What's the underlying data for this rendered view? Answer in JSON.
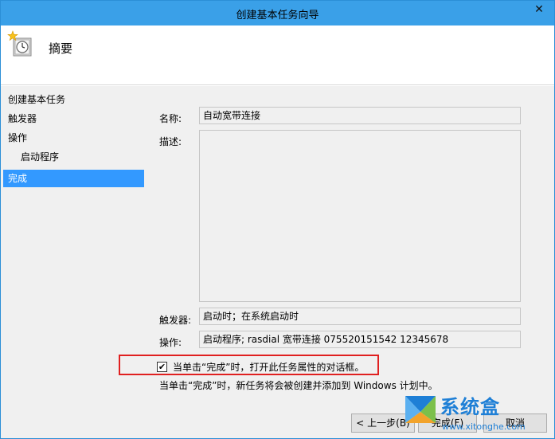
{
  "window": {
    "title": "创建基本任务向导",
    "close_glyph": "✕"
  },
  "header": {
    "title": "摘要",
    "icon": "task-clock-icon"
  },
  "sidebar": {
    "items": [
      {
        "label": "创建基本任务",
        "active": false,
        "sub": false
      },
      {
        "label": "触发器",
        "active": false,
        "sub": false
      },
      {
        "label": "操作",
        "active": false,
        "sub": false
      },
      {
        "label": "启动程序",
        "active": false,
        "sub": true
      },
      {
        "label": "完成",
        "active": true,
        "sub": false
      }
    ]
  },
  "summary": {
    "name_label": "名称:",
    "name_value": "自动宽带连接",
    "description_label": "描述:",
    "description_value": "",
    "trigger_label": "触发器:",
    "trigger_value": "启动时；在系统启动时",
    "action_label": "操作:",
    "action_value": "启动程序; rasdial 宽带连接 075520151542 12345678"
  },
  "option": {
    "checkbox_label": "当单击“完成”时，打开此任务属性的对话框。",
    "checked": true,
    "check_glyph": "✔"
  },
  "note": "当单击“完成”时，新任务将会被创建并添加到 Windows 计划中。",
  "buttons": {
    "back": "< 上一步(B)",
    "finish": "完成(F)",
    "cancel": "取消"
  },
  "watermark": {
    "text": "系统盒",
    "url": "www.xitonghe.com",
    "color": "#1e7fd6"
  },
  "colors": {
    "titlebar": "#3aa0e8",
    "selected": "#3399ff",
    "highlight_border": "#e02020"
  }
}
